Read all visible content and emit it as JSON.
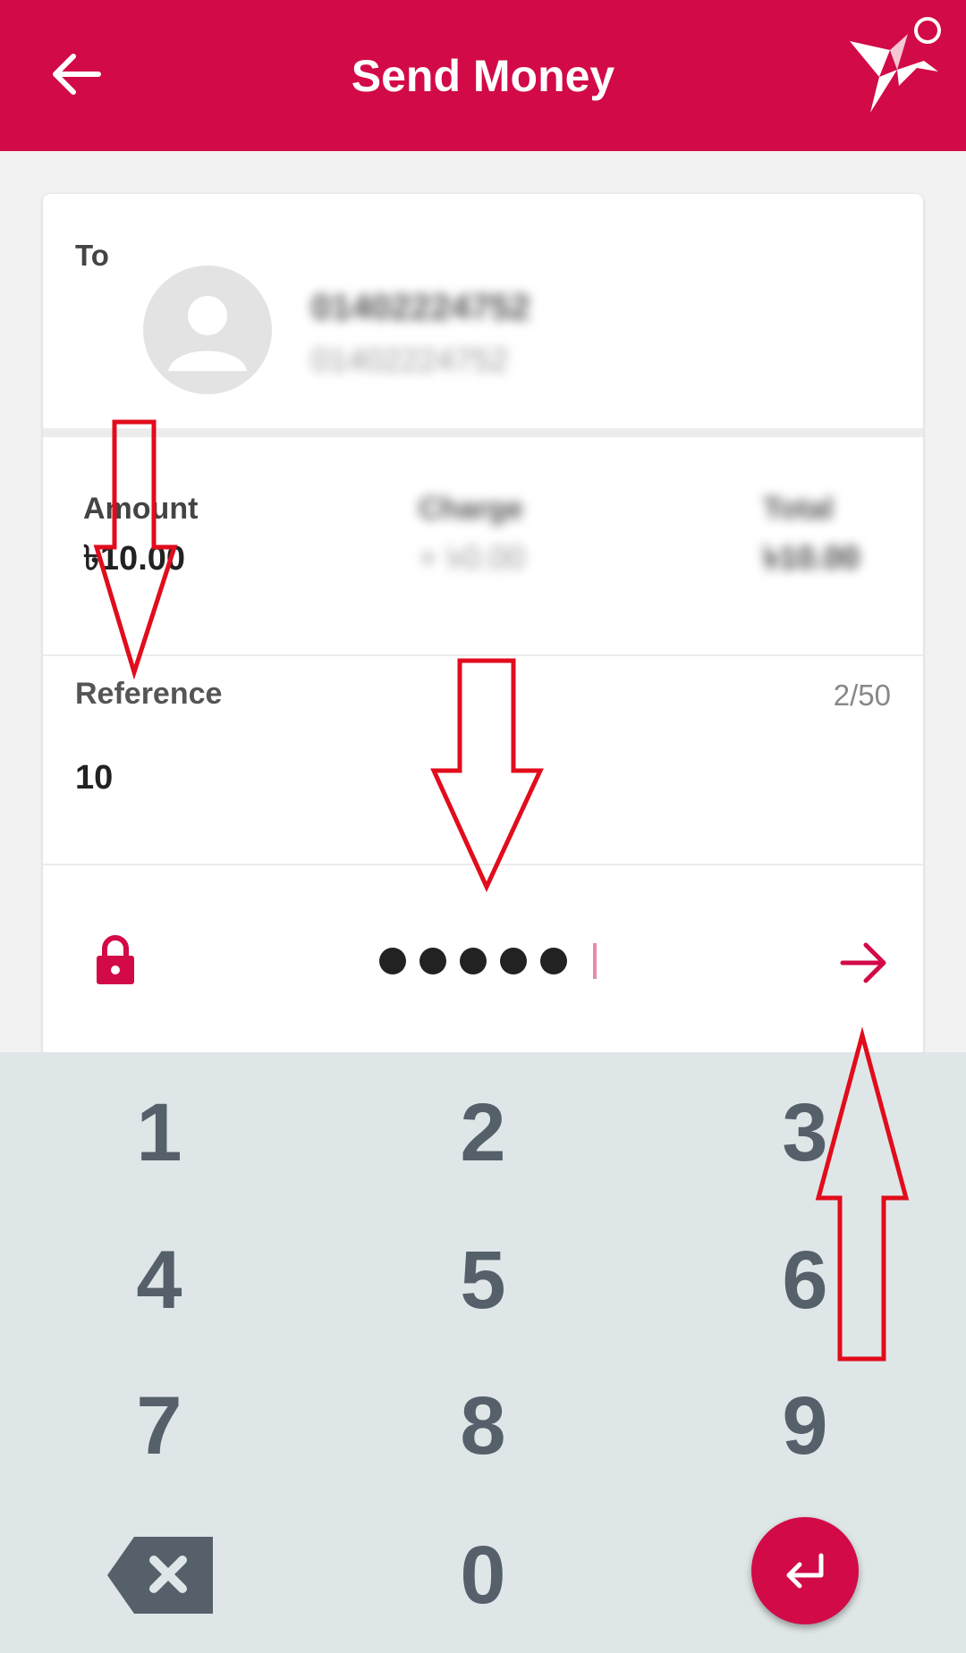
{
  "header": {
    "title": "Send Money",
    "brand_color": "#d20a47"
  },
  "recipient": {
    "to_label": "To",
    "name": "01402224752",
    "number": "01402224752"
  },
  "amounts": {
    "amount_label": "Amount",
    "amount_value": "৳10.00",
    "charge_label": "Charge",
    "charge_value": "+ ৳0.00",
    "total_label": "Total",
    "total_value": "৳10.00"
  },
  "reference": {
    "label": "Reference",
    "counter": "2/50",
    "value": "10"
  },
  "pin": {
    "digits_entered": 5
  },
  "keypad": {
    "keys": [
      "1",
      "2",
      "3",
      "4",
      "5",
      "6",
      "7",
      "8",
      "9",
      "0"
    ]
  },
  "icons": {
    "back": "arrow-left-icon",
    "logo": "paper-bird-logo-icon",
    "lock": "lock-icon",
    "submit": "arrow-right-icon",
    "backspace": "backspace-icon",
    "enter": "enter-icon"
  }
}
